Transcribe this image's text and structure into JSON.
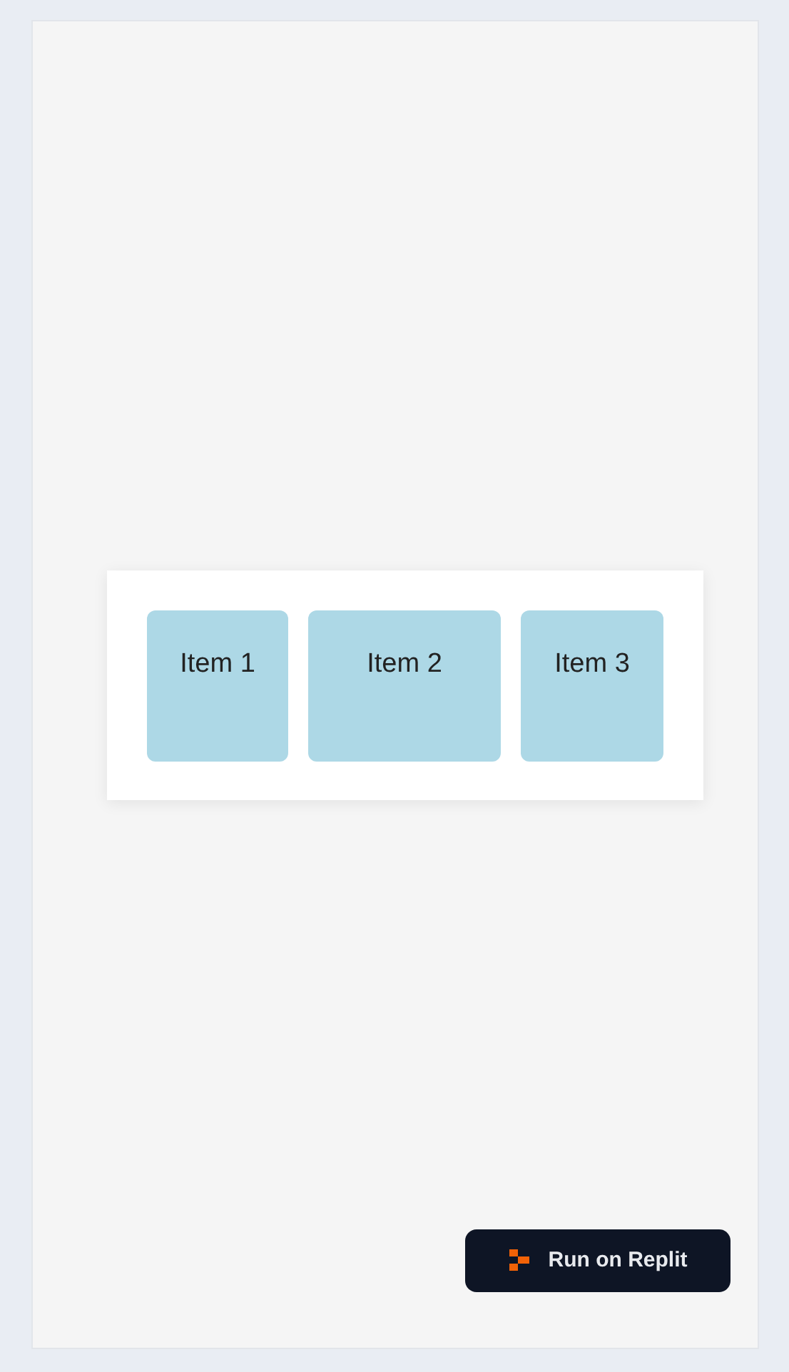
{
  "items": [
    {
      "label": "Item 1"
    },
    {
      "label": "Item 2"
    },
    {
      "label": "Item 3"
    }
  ],
  "run_button": {
    "label": "Run on Replit"
  }
}
